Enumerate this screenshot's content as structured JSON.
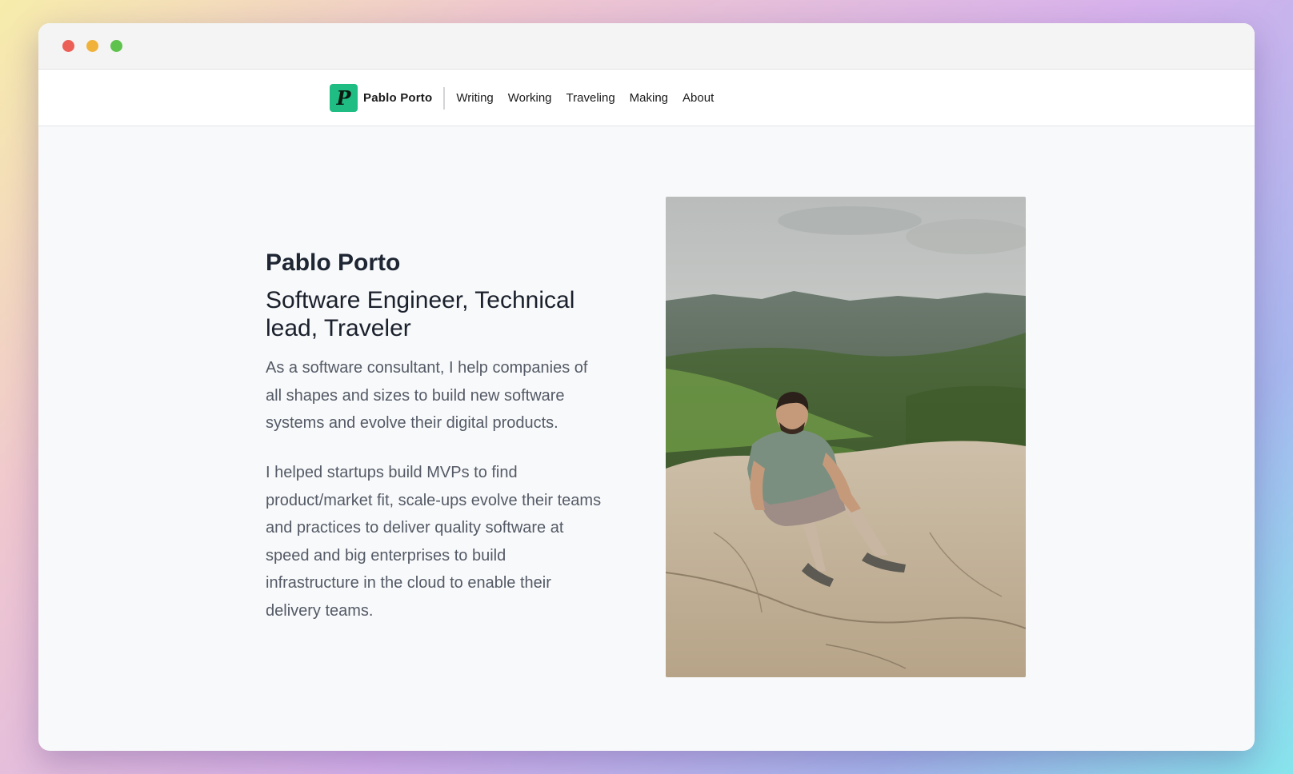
{
  "window": {
    "controls": [
      "close",
      "minimize",
      "zoom"
    ]
  },
  "nav": {
    "logo_letter": "P",
    "brand": "Pablo Porto",
    "links": [
      "Writing",
      "Working",
      "Traveling",
      "Making",
      "About"
    ]
  },
  "hero": {
    "name": "Pablo Porto",
    "tagline": "Software Engineer, Technical lead, Traveler",
    "paragraphs": [
      "As a software consultant, I help companies of all shapes and sizes to build new software systems and evolve their digital products.",
      "I helped startups build MVPs to find product/market fit, scale-ups evolve their teams and practices to deliver quality software at speed and big enterprises to build infrastructure in the cloud to enable their delivery teams."
    ]
  },
  "colors": {
    "logo_bg": "#1fbd84",
    "heading": "#1e2533",
    "body_text": "#545a66"
  }
}
